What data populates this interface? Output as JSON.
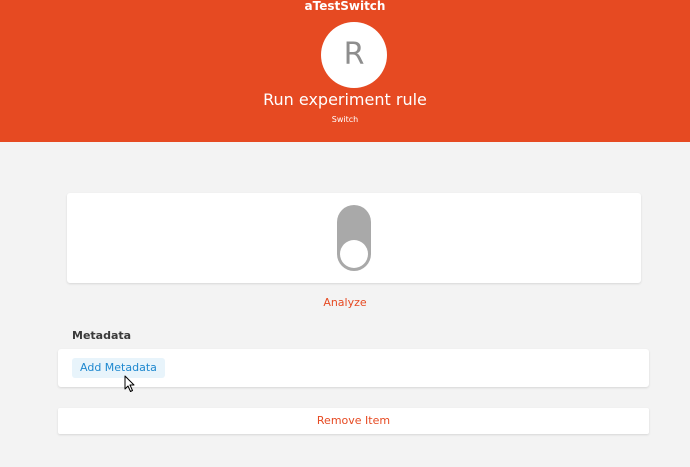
{
  "header": {
    "app_title": "aTestSwitch",
    "avatar_letter": "R",
    "rule_title": "Run experiment rule",
    "rule_type": "Switch"
  },
  "switch_control": {
    "state": "off",
    "icon": "toggle-switch-icon"
  },
  "actions": {
    "analyze_label": "Analyze",
    "remove_label": "Remove Item"
  },
  "metadata": {
    "section_label": "Metadata",
    "add_label": "Add Metadata"
  },
  "colors": {
    "accent": "#e64a22",
    "toggle_off": "#a9a9a9",
    "link_blue": "#1e88cf",
    "background": "#f3f3f3"
  }
}
